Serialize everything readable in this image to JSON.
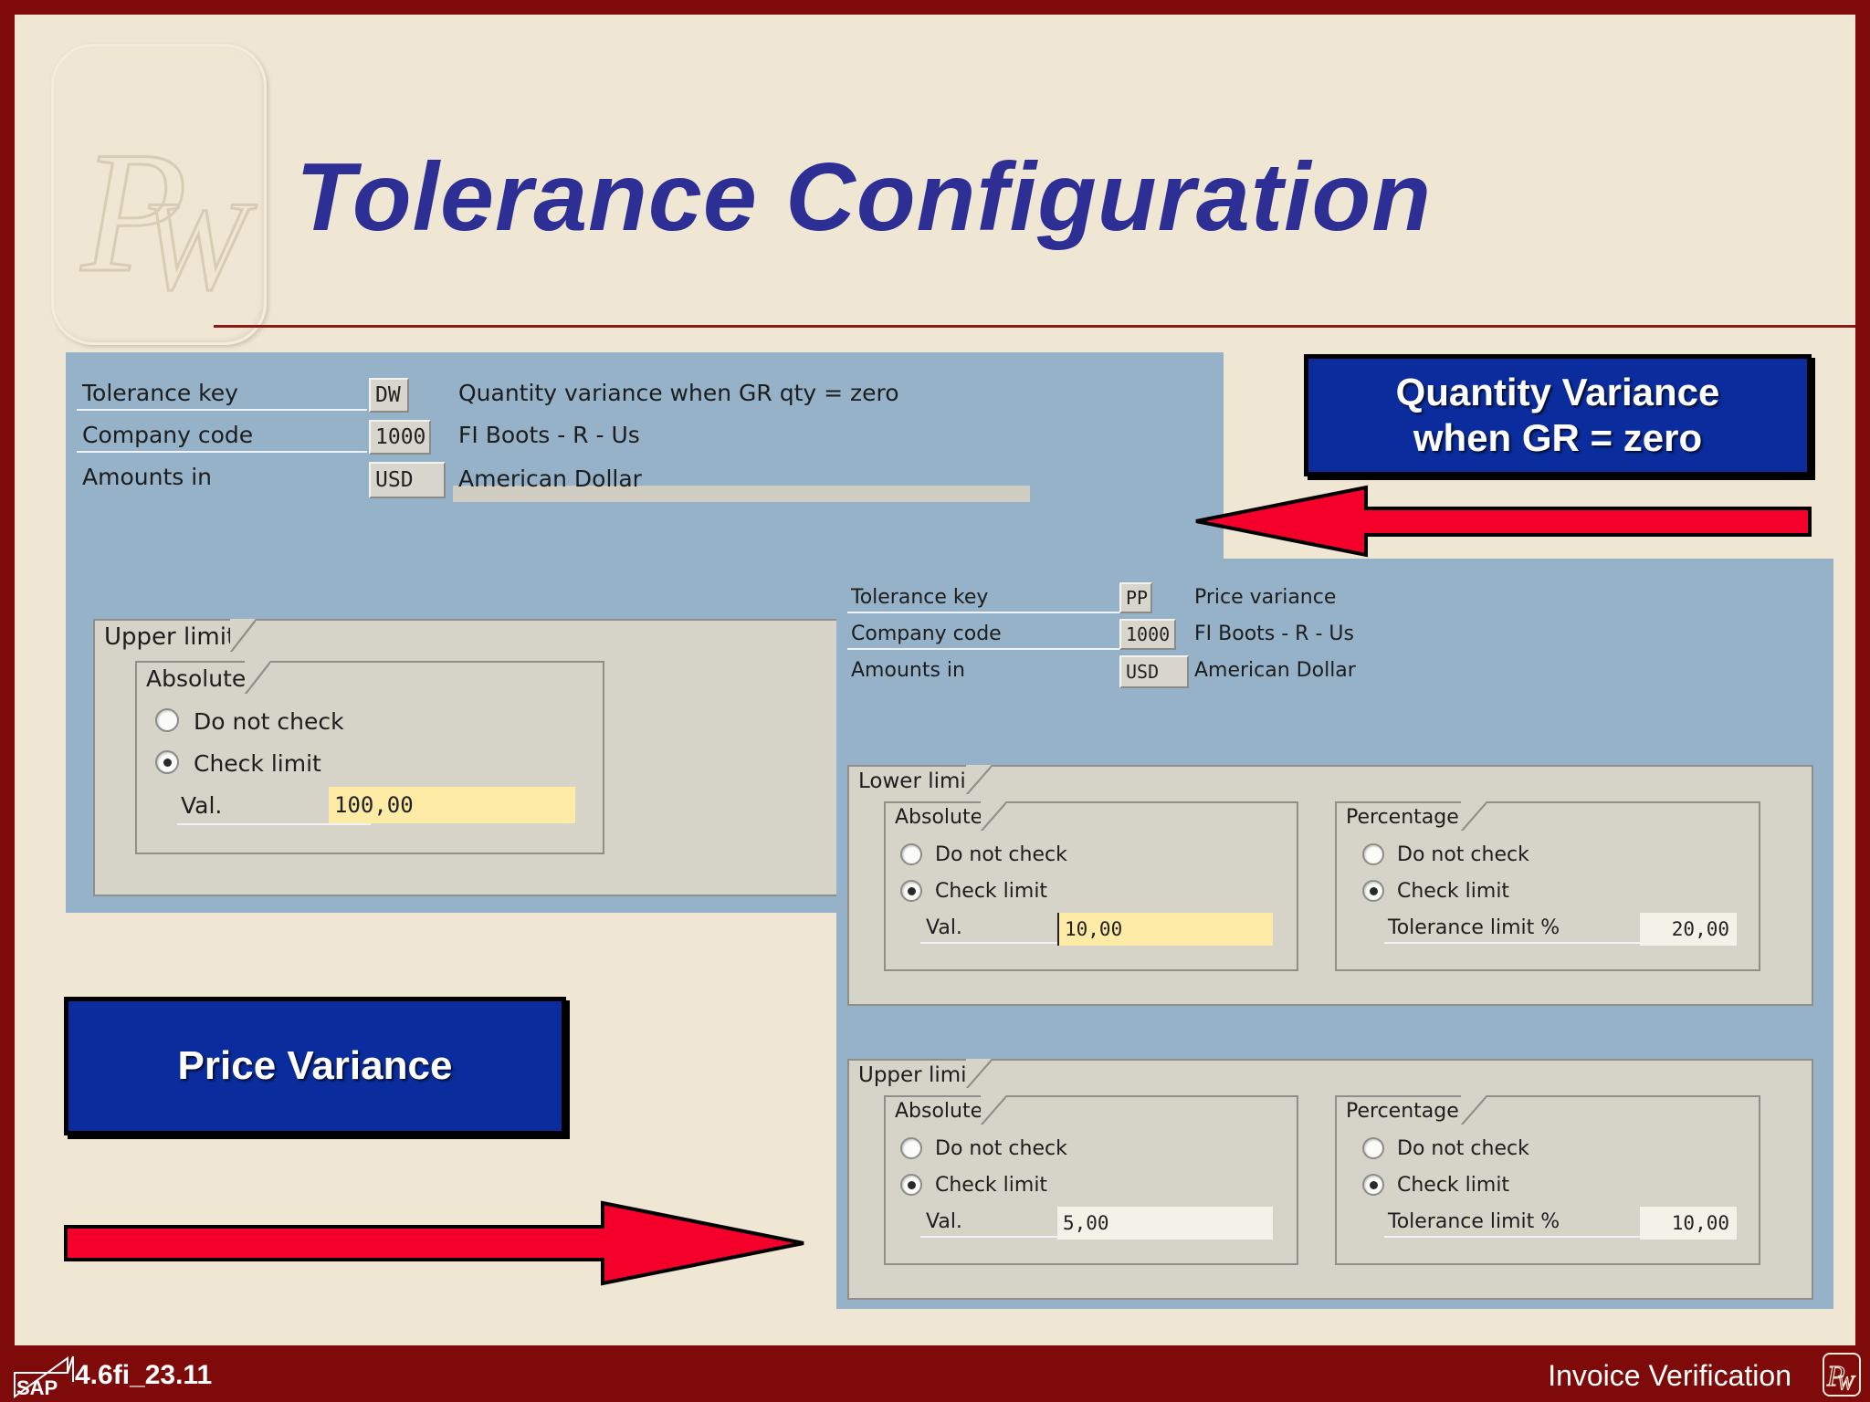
{
  "title": "Tolerance Configuration",
  "logo_text": "PW",
  "callouts": {
    "quantity_variance": "Quantity Variance\nwhen GR = zero",
    "price_variance": "Price Variance"
  },
  "screen_dw": {
    "header": {
      "tolerance_key_label": "Tolerance key",
      "tolerance_key_value": "DW",
      "tolerance_key_desc": "Quantity variance when GR qty = zero",
      "company_code_label": "Company code",
      "company_code_value": "1000",
      "company_code_desc": "FI Boots - R - Us",
      "amounts_in_label": "Amounts in",
      "amounts_in_value": "USD",
      "amounts_in_desc": "American Dollar"
    },
    "upper_limit": {
      "title": "Upper limit",
      "absolute": {
        "title": "Absolute",
        "do_not_check": "Do not check",
        "check_limit": "Check limit",
        "selected": "check_limit",
        "val_label": "Val.",
        "val_value": "100,00"
      }
    }
  },
  "screen_pp": {
    "header": {
      "tolerance_key_label": "Tolerance key",
      "tolerance_key_value": "PP",
      "tolerance_key_desc": "Price variance",
      "company_code_label": "Company code",
      "company_code_value": "1000",
      "company_code_desc": "FI Boots - R - Us",
      "amounts_in_label": "Amounts in",
      "amounts_in_value": "USD",
      "amounts_in_desc": "American Dollar"
    },
    "lower_limit": {
      "title": "Lower limit",
      "absolute": {
        "title": "Absolute",
        "do_not_check": "Do not check",
        "check_limit": "Check limit",
        "selected": "check_limit",
        "val_label": "Val.",
        "val_value": "10,00"
      },
      "percentage": {
        "title": "Percentage",
        "do_not_check": "Do not check",
        "check_limit": "Check limit",
        "selected": "check_limit",
        "tol_label": "Tolerance limit %",
        "tol_value": "20,00"
      }
    },
    "upper_limit": {
      "title": "Upper limit",
      "absolute": {
        "title": "Absolute",
        "do_not_check": "Do not check",
        "check_limit": "Check limit",
        "selected": "check_limit",
        "val_label": "Val.",
        "val_value": "5,00"
      },
      "percentage": {
        "title": "Percentage",
        "do_not_check": "Do not check",
        "check_limit": "Check limit",
        "selected": "check_limit",
        "tol_label": "Tolerance limit %",
        "tol_value": "10,00"
      }
    }
  },
  "footer": {
    "sap_mark": "SAP",
    "code": "4.6fi_23.11",
    "title": "Invoice Verification"
  },
  "colors": {
    "border": "#7e0a0a",
    "slide_bg": "#efe6d4",
    "title": "#2d2f94",
    "sap_panel": "#96b2c8",
    "callout_blue": "#0a2c9c",
    "arrow_red": "#f5002a",
    "input_yellow": "#fdeba6"
  }
}
